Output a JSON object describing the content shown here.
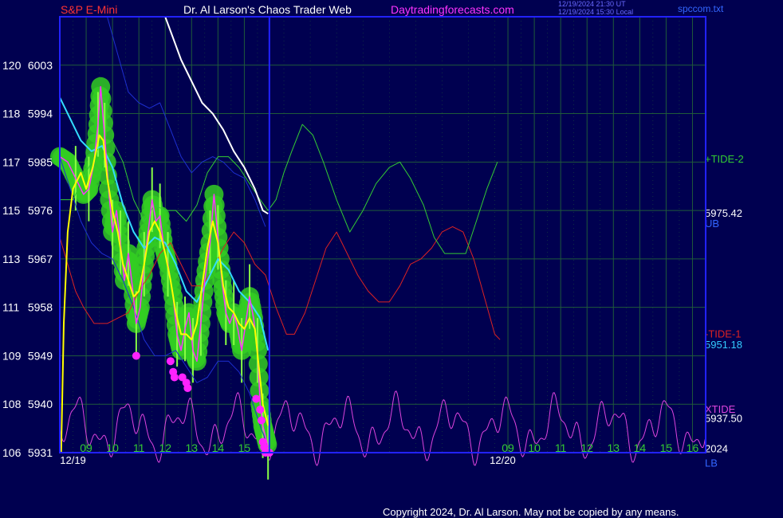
{
  "header": {
    "left": "S&P E-Mini",
    "center": "Dr. Al Larson's Chaos Trader Web",
    "site": "Daytradingforecasts.com",
    "ts_ut": "12/19/2024 21:30 UT",
    "ts_local": "12/19/2024 15:30 Local",
    "file": "spccom.txt"
  },
  "footer": {
    "copyright": "Copyright 2024, Dr. Al Larson. May not be copied by any means."
  },
  "colors": {
    "background": "#000050",
    "grid": "#1f5a3a",
    "frame": "#2222ff",
    "price": "#ff33ff",
    "smooth": "#ffff00",
    "average": "#33ddff",
    "glow": "#33cc22",
    "tide2": "#33cc33",
    "tide1": "#dd2222",
    "xtide": "#dd44dd",
    "envelope": "#1d2fd0",
    "white_line": "#ffffff",
    "dots": "#ff22ff"
  },
  "chart_data": {
    "type": "line",
    "y_labels": [
      {
        "left": "120",
        "price": "6003",
        "value": 6003
      },
      {
        "left": "118",
        "price": "5994",
        "value": 5994
      },
      {
        "left": "117",
        "price": "5985",
        "value": 5985
      },
      {
        "left": "115",
        "price": "5976",
        "value": 5976
      },
      {
        "left": "113",
        "price": "5967",
        "value": 5967
      },
      {
        "left": "111",
        "price": "5958",
        "value": 5958
      },
      {
        "left": "109",
        "price": "5949",
        "value": 5949
      },
      {
        "left": "108",
        "price": "5940",
        "value": 5940
      },
      {
        "left": "106",
        "price": "5931",
        "value": 5931
      }
    ],
    "ylim": [
      5931,
      6012
    ],
    "x_ticks": [
      "09",
      "10",
      "11",
      "12",
      "13",
      "14",
      "15",
      "09",
      "10",
      "11",
      "12",
      "13",
      "14",
      "15",
      "16"
    ],
    "x_tick_hours": [
      9,
      10,
      11,
      12,
      13,
      14,
      15,
      25,
      26,
      27,
      28,
      29,
      30,
      31,
      32
    ],
    "dates": [
      {
        "label": "12/19",
        "hour": 8.5
      },
      {
        "label": "12/20",
        "hour": 24.8
      }
    ],
    "xlim": [
      8.0,
      32.5
    ],
    "right_labels": [
      {
        "text": "+TIDE-2",
        "value": 5985.5,
        "color": "#33cc33"
      },
      {
        "text": "5975.42",
        "value": 5975.4,
        "color": "#ffffff"
      },
      {
        "text": "UB",
        "value": 5973.5,
        "color": "#3366ff"
      },
      {
        "text": "-TIDE-1",
        "value": 5953.0,
        "color": "#dd2222"
      },
      {
        "text": "5951.18",
        "value": 5951.0,
        "color": "#33ccff"
      },
      {
        "text": "XTIDE",
        "value": 5939.0,
        "color": "#dd44dd"
      },
      {
        "text": "5937.50",
        "value": 5937.3,
        "color": "#ffffff"
      },
      {
        "text": "2024",
        "value": 5931.7,
        "color": "#ffffff"
      },
      {
        "text": "LB",
        "value": 5929.0,
        "color": "#3366ff"
      }
    ],
    "series": [
      {
        "key": "price",
        "color": "#ff33ff",
        "width": 1.5,
        "points": [
          [
            8.0,
            5986
          ],
          [
            8.3,
            5985
          ],
          [
            8.6,
            5982
          ],
          [
            8.9,
            5979
          ],
          [
            9.1,
            5980
          ],
          [
            9.3,
            5985
          ],
          [
            9.45,
            5992
          ],
          [
            9.55,
            5999
          ],
          [
            9.7,
            5990
          ],
          [
            9.85,
            5980
          ],
          [
            10.0,
            5972
          ],
          [
            10.15,
            5976
          ],
          [
            10.3,
            5970
          ],
          [
            10.45,
            5963
          ],
          [
            10.6,
            5968
          ],
          [
            10.75,
            5962
          ],
          [
            10.9,
            5955
          ],
          [
            11.05,
            5958
          ],
          [
            11.2,
            5966
          ],
          [
            11.35,
            5972
          ],
          [
            11.5,
            5978
          ],
          [
            11.65,
            5974
          ],
          [
            11.8,
            5975
          ],
          [
            11.95,
            5969
          ],
          [
            12.1,
            5966
          ],
          [
            12.3,
            5960
          ],
          [
            12.45,
            5953
          ],
          [
            12.6,
            5950
          ],
          [
            12.75,
            5954
          ],
          [
            12.9,
            5957
          ],
          [
            13.05,
            5950
          ],
          [
            13.2,
            5948
          ],
          [
            13.35,
            5955
          ],
          [
            13.5,
            5963
          ],
          [
            13.7,
            5970
          ],
          [
            13.85,
            5979
          ],
          [
            14.0,
            5971
          ],
          [
            14.15,
            5963
          ],
          [
            14.3,
            5957
          ],
          [
            14.45,
            5955
          ],
          [
            14.6,
            5957
          ],
          [
            14.75,
            5954
          ],
          [
            14.9,
            5950
          ],
          [
            15.05,
            5955
          ],
          [
            15.2,
            5960
          ],
          [
            15.35,
            5956
          ],
          [
            15.5,
            5950
          ],
          [
            15.6,
            5940
          ],
          [
            15.7,
            5936
          ],
          [
            15.8,
            5934
          ],
          [
            15.9,
            5932
          ]
        ]
      },
      {
        "key": "smooth",
        "color": "#ffff00",
        "width": 2,
        "points": [
          [
            8.05,
            5931
          ],
          [
            8.15,
            5955
          ],
          [
            8.3,
            5972
          ],
          [
            8.5,
            5980
          ],
          [
            8.8,
            5983
          ],
          [
            9.0,
            5980
          ],
          [
            9.25,
            5984
          ],
          [
            9.5,
            5990
          ],
          [
            9.65,
            5989
          ],
          [
            9.8,
            5982
          ],
          [
            10.0,
            5976
          ],
          [
            10.2,
            5972
          ],
          [
            10.4,
            5966
          ],
          [
            10.6,
            5963
          ],
          [
            10.8,
            5960
          ],
          [
            11.0,
            5961
          ],
          [
            11.2,
            5966
          ],
          [
            11.4,
            5972
          ],
          [
            11.6,
            5974
          ],
          [
            11.8,
            5972
          ],
          [
            12.0,
            5968
          ],
          [
            12.2,
            5963
          ],
          [
            12.4,
            5957
          ],
          [
            12.6,
            5953
          ],
          [
            12.8,
            5953
          ],
          [
            13.0,
            5952
          ],
          [
            13.2,
            5955
          ],
          [
            13.4,
            5962
          ],
          [
            13.6,
            5969
          ],
          [
            13.8,
            5974
          ],
          [
            14.0,
            5970
          ],
          [
            14.2,
            5962
          ],
          [
            14.4,
            5958
          ],
          [
            14.6,
            5957
          ],
          [
            14.8,
            5955
          ],
          [
            15.0,
            5954
          ],
          [
            15.2,
            5956
          ],
          [
            15.4,
            5954
          ],
          [
            15.55,
            5947
          ],
          [
            15.7,
            5940
          ],
          [
            15.9,
            5936
          ]
        ]
      },
      {
        "key": "average",
        "color": "#33ddff",
        "width": 2,
        "points": [
          [
            8.0,
            5997
          ],
          [
            8.4,
            5993
          ],
          [
            8.8,
            5989
          ],
          [
            9.2,
            5987
          ],
          [
            9.6,
            5988
          ],
          [
            10.0,
            5984
          ],
          [
            10.4,
            5977
          ],
          [
            10.8,
            5972
          ],
          [
            11.2,
            5969
          ],
          [
            11.6,
            5971
          ],
          [
            12.0,
            5970
          ],
          [
            12.4,
            5966
          ],
          [
            12.8,
            5961
          ],
          [
            13.2,
            5959
          ],
          [
            13.6,
            5963
          ],
          [
            14.0,
            5967
          ],
          [
            14.4,
            5965
          ],
          [
            14.8,
            5961
          ],
          [
            15.2,
            5959
          ],
          [
            15.6,
            5956
          ],
          [
            15.9,
            5950
          ]
        ]
      },
      {
        "key": "tide2",
        "color": "#33cc33",
        "width": 1,
        "points": [
          [
            8.0,
            5978
          ],
          [
            8.5,
            5978
          ],
          [
            9.0,
            5983
          ],
          [
            9.5,
            5988
          ],
          [
            10.0,
            5989
          ],
          [
            10.4,
            5985
          ],
          [
            10.8,
            5978
          ],
          [
            11.2,
            5974
          ],
          [
            11.6,
            5977
          ],
          [
            12.0,
            5976
          ],
          [
            12.4,
            5976
          ],
          [
            12.8,
            5974
          ],
          [
            13.2,
            5977
          ],
          [
            13.6,
            5983
          ],
          [
            14.0,
            5986
          ],
          [
            14.4,
            5986
          ],
          [
            14.8,
            5984
          ],
          [
            15.2,
            5981
          ],
          [
            15.6,
            5978
          ],
          [
            15.9,
            5976
          ],
          [
            16.2,
            5978
          ],
          [
            16.5,
            5983
          ],
          [
            16.8,
            5987
          ],
          [
            17.2,
            5992
          ],
          [
            17.6,
            5990
          ],
          [
            18.0,
            5985
          ],
          [
            18.5,
            5978
          ],
          [
            19.0,
            5972
          ],
          [
            19.5,
            5976
          ],
          [
            20.0,
            5981
          ],
          [
            20.5,
            5984
          ],
          [
            20.9,
            5985
          ],
          [
            21.3,
            5982
          ],
          [
            21.8,
            5977
          ],
          [
            22.2,
            5971
          ],
          [
            22.6,
            5968
          ],
          [
            23.0,
            5968
          ],
          [
            23.4,
            5968
          ],
          [
            23.8,
            5974
          ],
          [
            24.2,
            5980
          ],
          [
            24.6,
            5985
          ]
        ]
      },
      {
        "key": "tide1",
        "color": "#dd2222",
        "width": 1,
        "points": [
          [
            8.0,
            5971
          ],
          [
            8.3,
            5966
          ],
          [
            8.6,
            5961
          ],
          [
            8.9,
            5958
          ],
          [
            9.3,
            5955
          ],
          [
            9.8,
            5955
          ],
          [
            10.2,
            5956
          ],
          [
            10.6,
            5957
          ],
          [
            11.0,
            5961
          ],
          [
            11.4,
            5964
          ],
          [
            11.8,
            5968
          ],
          [
            12.2,
            5970
          ],
          [
            12.6,
            5966
          ],
          [
            13.0,
            5962
          ],
          [
            13.4,
            5962
          ],
          [
            13.8,
            5965
          ],
          [
            14.2,
            5969
          ],
          [
            14.6,
            5972
          ],
          [
            15.0,
            5970
          ],
          [
            15.4,
            5966
          ],
          [
            15.8,
            5964
          ],
          [
            16.2,
            5958
          ],
          [
            16.6,
            5953
          ],
          [
            16.9,
            5953
          ],
          [
            17.3,
            5957
          ],
          [
            17.7,
            5963
          ],
          [
            18.1,
            5969
          ],
          [
            18.5,
            5972
          ],
          [
            18.9,
            5968
          ],
          [
            19.3,
            5964
          ],
          [
            19.7,
            5961
          ],
          [
            20.1,
            5959
          ],
          [
            20.5,
            5959
          ],
          [
            20.9,
            5962
          ],
          [
            21.3,
            5966
          ],
          [
            21.7,
            5967
          ],
          [
            22.1,
            5969
          ],
          [
            22.5,
            5972
          ],
          [
            22.9,
            5973
          ],
          [
            23.3,
            5972
          ],
          [
            23.7,
            5967
          ],
          [
            24.1,
            5960
          ],
          [
            24.5,
            5953
          ],
          [
            24.7,
            5952
          ]
        ]
      },
      {
        "key": "ub",
        "color": "#1d2fd0",
        "width": 1,
        "points": [
          [
            9.8,
            6012
          ],
          [
            10.2,
            6005
          ],
          [
            10.6,
            5998
          ],
          [
            11.0,
            5996
          ],
          [
            11.4,
            5995
          ],
          [
            11.8,
            5996
          ],
          [
            12.2,
            5991
          ],
          [
            12.6,
            5986
          ],
          [
            13.0,
            5983
          ],
          [
            13.4,
            5985
          ],
          [
            13.8,
            5986
          ],
          [
            14.2,
            5985
          ],
          [
            14.6,
            5983
          ],
          [
            15.0,
            5982
          ],
          [
            15.4,
            5978
          ],
          [
            15.8,
            5973
          ]
        ]
      },
      {
        "key": "lb",
        "color": "#1d2fd0",
        "width": 1,
        "points": [
          [
            8.0,
            5986
          ],
          [
            8.4,
            5980
          ],
          [
            8.8,
            5974
          ],
          [
            9.2,
            5970
          ],
          [
            9.6,
            5968
          ],
          [
            10.0,
            5967
          ],
          [
            10.4,
            5963
          ],
          [
            10.8,
            5958
          ],
          [
            11.2,
            5952
          ],
          [
            11.6,
            5949
          ],
          [
            12.0,
            5949
          ],
          [
            12.4,
            5950
          ],
          [
            12.8,
            5947
          ],
          [
            13.2,
            5944
          ],
          [
            13.6,
            5945
          ],
          [
            14.0,
            5948
          ],
          [
            14.4,
            5948
          ],
          [
            14.8,
            5946
          ],
          [
            15.2,
            5942
          ],
          [
            15.6,
            5936
          ],
          [
            15.9,
            5932
          ]
        ]
      },
      {
        "key": "white",
        "color": "#ffffff",
        "width": 2,
        "points": [
          [
            12.0,
            6012
          ],
          [
            12.3,
            6008
          ],
          [
            12.6,
            6004
          ],
          [
            13.0,
            6000
          ],
          [
            13.4,
            5996
          ],
          [
            13.8,
            5994
          ],
          [
            14.2,
            5991
          ],
          [
            14.6,
            5987
          ],
          [
            15.0,
            5984
          ],
          [
            15.4,
            5980
          ],
          [
            15.7,
            5976
          ],
          [
            15.9,
            5975.4
          ]
        ]
      }
    ],
    "xtide": {
      "key": "xtide",
      "color": "#dd44dd",
      "center": 5935.5,
      "start": 8.0,
      "end": 32.5
    },
    "dots": [
      {
        "x": 10.9,
        "y": 5949
      },
      {
        "x": 12.2,
        "y": 5948
      },
      {
        "x": 12.3,
        "y": 5946
      },
      {
        "x": 12.35,
        "y": 5945
      },
      {
        "x": 12.65,
        "y": 5945
      },
      {
        "x": 12.8,
        "y": 5944
      },
      {
        "x": 12.85,
        "y": 5943
      },
      {
        "x": 15.45,
        "y": 5941
      },
      {
        "x": 15.6,
        "y": 5939
      },
      {
        "x": 15.65,
        "y": 5937
      },
      {
        "x": 15.7,
        "y": 5933
      },
      {
        "x": 15.75,
        "y": 5932
      },
      {
        "x": 15.8,
        "y": 5931
      },
      {
        "x": 15.95,
        "y": 5931
      }
    ]
  }
}
